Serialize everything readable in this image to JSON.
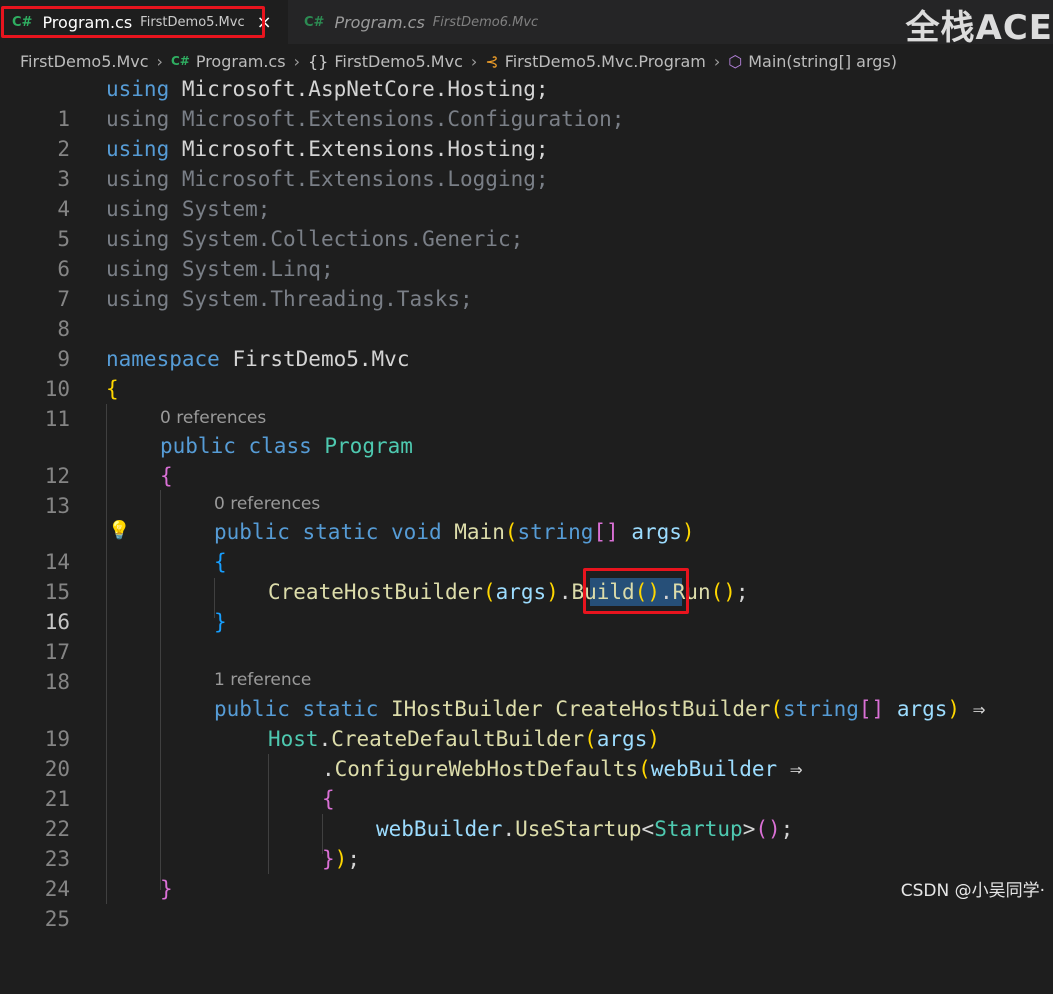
{
  "tabs": [
    {
      "icon": "C#",
      "file": "Program.cs",
      "project": "FirstDemo5.Mvc",
      "close": "×"
    },
    {
      "icon": "C#",
      "file": "Program.cs",
      "project": "FirstDemo6.Mvc"
    }
  ],
  "watermark_top": "全栈ACE",
  "breadcrumb": {
    "project": "FirstDemo5.Mvc",
    "file_icon": "C#",
    "file": "Program.cs",
    "namespace_icon": "{}",
    "namespace": "FirstDemo5.Mvc",
    "class": "FirstDemo5.Mvc.Program",
    "method": "Main(string[] args)"
  },
  "codelens": {
    "line12": "0 references",
    "line14": "0 references",
    "line19": "1 reference"
  },
  "line_numbers": [
    "1",
    "2",
    "3",
    "4",
    "5",
    "6",
    "7",
    "8",
    "9",
    "10",
    "11",
    "12",
    "13",
    "14",
    "15",
    "16",
    "17",
    "18",
    "19",
    "20",
    "21",
    "22",
    "23",
    "24",
    "25"
  ],
  "code": {
    "l1": {
      "kw": "using",
      "rest": "Microsoft.AspNetCore.Hosting;"
    },
    "l2": {
      "kw": "using",
      "rest": "Microsoft.Extensions.Configuration;"
    },
    "l3": {
      "kw": "using",
      "rest": "Microsoft.Extensions.Hosting;"
    },
    "l4": {
      "kw": "using",
      "rest": "Microsoft.Extensions.Logging;"
    },
    "l5": {
      "kw": "using",
      "rest": "System;"
    },
    "l6": {
      "kw": "using",
      "rest": "System.Collections.Generic;"
    },
    "l7": {
      "kw": "using",
      "rest": "System.Linq;"
    },
    "l8": {
      "kw": "using",
      "rest": "System.Threading.Tasks;"
    },
    "l10": {
      "kw": "namespace",
      "name": "FirstDemo5.Mvc"
    },
    "l11": "{",
    "l12": {
      "kw1": "public",
      "kw2": "class",
      "name": "Program"
    },
    "l13": "{",
    "l14": {
      "kw1": "public",
      "kw2": "static",
      "kw3": "void",
      "fn": "Main",
      "p1": "(",
      "ty": "string",
      "br": "[]",
      "arg": "args",
      "p2": ")"
    },
    "l15": "{",
    "l16": {
      "fn1": "CreateHostBuilder",
      "p1": "(",
      "arg": "args",
      "p2": ")",
      "dot": ".",
      "fn2": "Build",
      "p3": "()",
      "dot2": ".",
      "fn3": "Run",
      "p4": "()",
      "semi": ";"
    },
    "l17": "}",
    "l19": {
      "kw1": "public",
      "kw2": "static",
      "ty": "IHostBuilder",
      "fn": "CreateHostBuilder",
      "p1": "(",
      "ty2": "string",
      "br": "[]",
      "arg": "args",
      "p2": ")",
      "arrow": "⇒"
    },
    "l20": {
      "ty": "Host",
      "dot": ".",
      "fn": "CreateDefaultBuilder",
      "p1": "(",
      "arg": "args",
      "p2": ")"
    },
    "l21": {
      "dot": ".",
      "fn": "ConfigureWebHostDefaults",
      "p1": "(",
      "arg": "webBuilder",
      "arrow": "⇒"
    },
    "l22": "{",
    "l23": {
      "obj": "webBuilder",
      "dot": ".",
      "fn": "UseStartup",
      "lt": "<",
      "ty": "Startup",
      "gt": ">",
      "p": "()",
      "semi": ";"
    },
    "l24": {
      "b": "}",
      "p": ")",
      "semi": ";"
    },
    "l25": "}"
  },
  "lightbulb": "💡",
  "watermark_bottom": "CSDN @小吴同学·"
}
